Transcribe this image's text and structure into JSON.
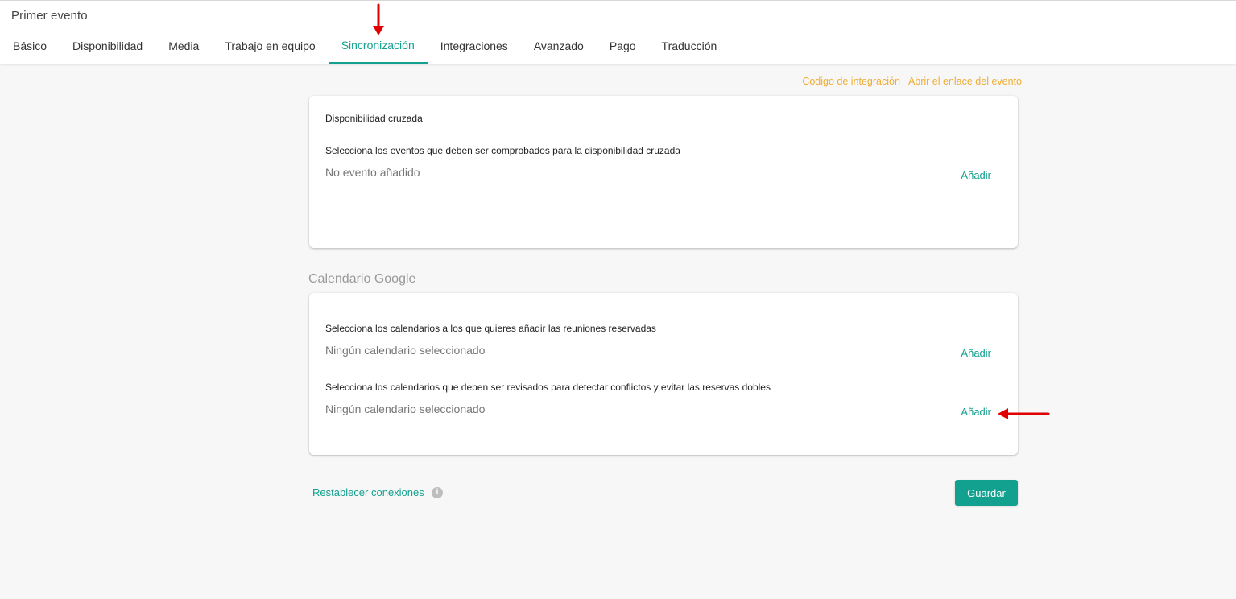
{
  "header": {
    "title": "Primer evento",
    "tabs": [
      {
        "label": "Básico"
      },
      {
        "label": "Disponibilidad"
      },
      {
        "label": "Media"
      },
      {
        "label": "Trabajo en equipo"
      },
      {
        "label": "Sincronización",
        "active": true
      },
      {
        "label": "Integraciones"
      },
      {
        "label": "Avanzado"
      },
      {
        "label": "Pago"
      },
      {
        "label": "Traducción"
      }
    ]
  },
  "top_links": {
    "integration_code": "Codigo de integración",
    "open_event_link": "Abrir el enlace del evento"
  },
  "cross_availability": {
    "title": "Disponibilidad cruzada",
    "label": "Selecciona los eventos que deben ser comprobados para la disponibilidad cruzada",
    "value": "No evento añadido",
    "add": "Añadir"
  },
  "google_calendar": {
    "heading": "Calendario Google",
    "add_meetings_label": "Selecciona los calendarios a los que quieres añadir las reuniones reservadas",
    "add_meetings_value": "Ningún calendario seleccionado",
    "add_meetings_add": "Añadir",
    "conflicts_label": "Selecciona los calendarios que deben ser revisados para detectar conflictos y evitar las reservas dobles",
    "conflicts_value": "Ningún calendario seleccionado",
    "conflicts_add": "Añadir"
  },
  "footer": {
    "reset_connections": "Restablecer conexiones",
    "info_icon": "i",
    "save": "Guardar"
  },
  "icons": {
    "annotation_arrow_down": "arrow-down-icon",
    "annotation_arrow_left": "arrow-left-icon",
    "info": "info-icon"
  },
  "colors": {
    "accent": "#12a08f",
    "link_orange": "#f0ad33",
    "annotation_red": "#e00000"
  }
}
